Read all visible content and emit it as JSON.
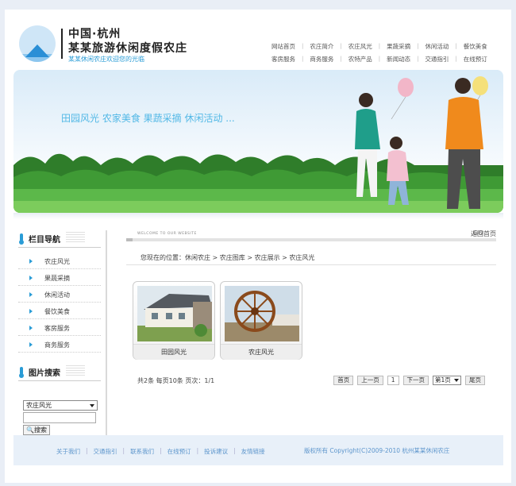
{
  "header": {
    "title_line1": "中国·杭州",
    "title_line2": "某某旅游休闲度假农庄",
    "subtitle": "某某休闲农庄欢迎您的光临"
  },
  "topnav": {
    "row1": [
      "网站首页",
      "农庄简介",
      "农庄风光",
      "果蔬采摘",
      "休闲活动",
      "餐饮美食"
    ],
    "row2": [
      "客房服务",
      "商务服务",
      "农特产品",
      "新闻动态",
      "交通指引",
      "在线预订"
    ]
  },
  "banner": {
    "slogan": "田园风光 农家美食 果蔬采摘 休闲活动 ..."
  },
  "sidebar": {
    "nav_title": "栏目导航",
    "items": [
      {
        "label": "农庄风光"
      },
      {
        "label": "果蔬采摘"
      },
      {
        "label": "休闲活动"
      },
      {
        "label": "餐饮美食"
      },
      {
        "label": "客房服务"
      },
      {
        "label": "商务服务"
      }
    ],
    "search_title": "图片搜索",
    "search_select": "农庄风光",
    "search_button": "搜索"
  },
  "main": {
    "welcome": "WELCOME TO OUR WEBSITE",
    "go_label": "GO",
    "back_label": "返回首页",
    "breadcrumb": "您现在的位置：休闲农庄  > 农庄图库  > 农庄展示  > 农庄风光",
    "thumbs": [
      {
        "caption": "田园风光"
      },
      {
        "caption": "农庄风光"
      }
    ],
    "pager_info": "共2条  每页10条  页次：1/1",
    "pager": {
      "first": "首页",
      "prev": "上一页",
      "current": "1",
      "next": "下一页",
      "select": "第1页",
      "last": "尾页"
    }
  },
  "footer": {
    "links": [
      "关于我们",
      "交通指引",
      "联系我们",
      "在线预订",
      "投诉建议",
      "友情链接"
    ],
    "copyright": "版权所有  Copyright(C)2009-2010 杭州某某休闲农庄"
  }
}
